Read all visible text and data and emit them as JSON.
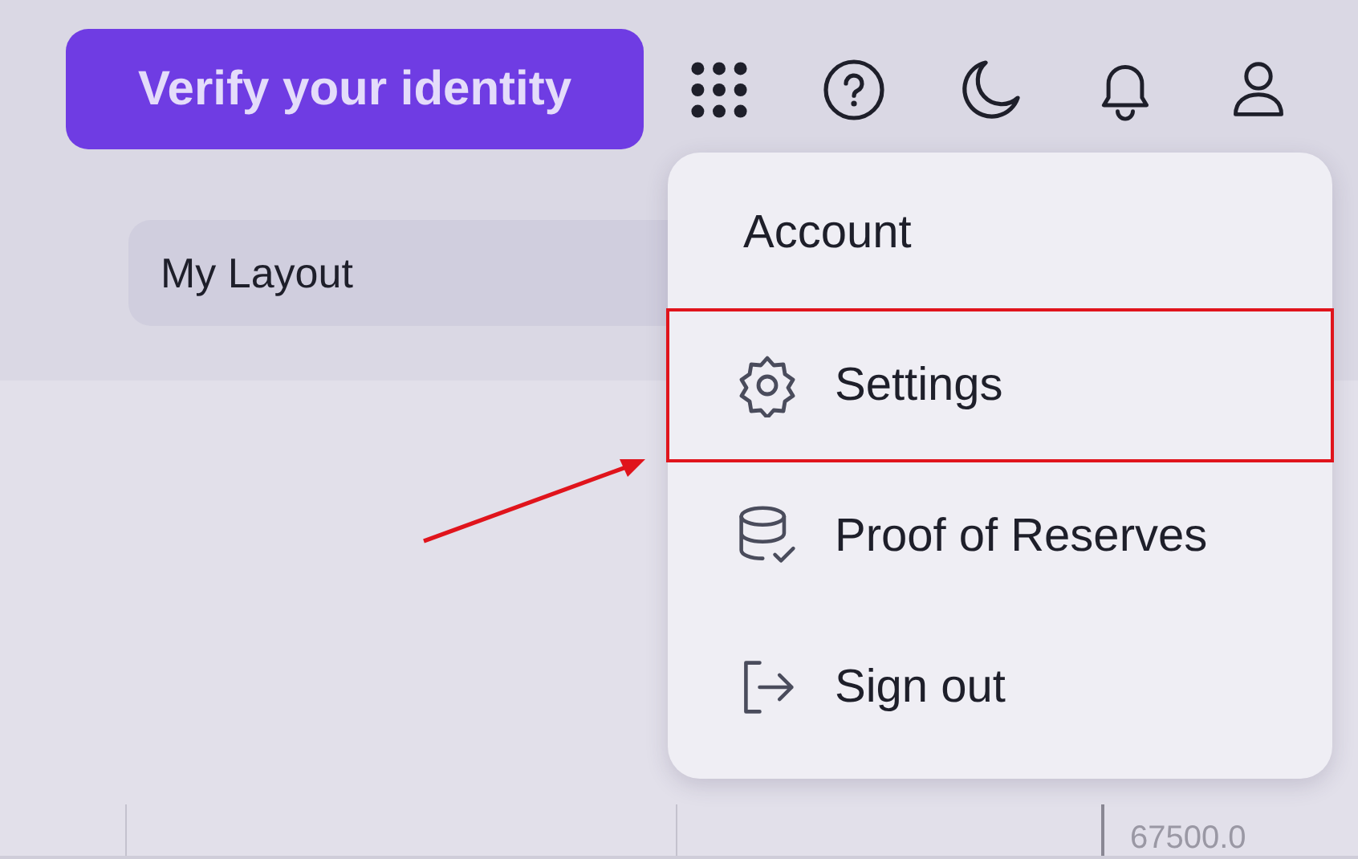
{
  "header": {
    "verify_button": "Verify your identity",
    "icons": [
      {
        "kind": "apps"
      },
      {
        "kind": "help"
      },
      {
        "kind": "theme"
      },
      {
        "kind": "notifications"
      },
      {
        "kind": "profile"
      }
    ]
  },
  "layout_selector": {
    "value": "My Layout"
  },
  "chart": {
    "price_label": "67500.0"
  },
  "account_menu": {
    "title": "Account",
    "items": [
      {
        "kind": "settings",
        "label": "Settings",
        "highlighted": true
      },
      {
        "kind": "reserves",
        "label": "Proof of Reserves",
        "highlighted": false
      },
      {
        "kind": "signout",
        "label": "Sign out",
        "highlighted": false
      }
    ]
  },
  "annotations": [
    {
      "kind": "arrow"
    }
  ]
}
